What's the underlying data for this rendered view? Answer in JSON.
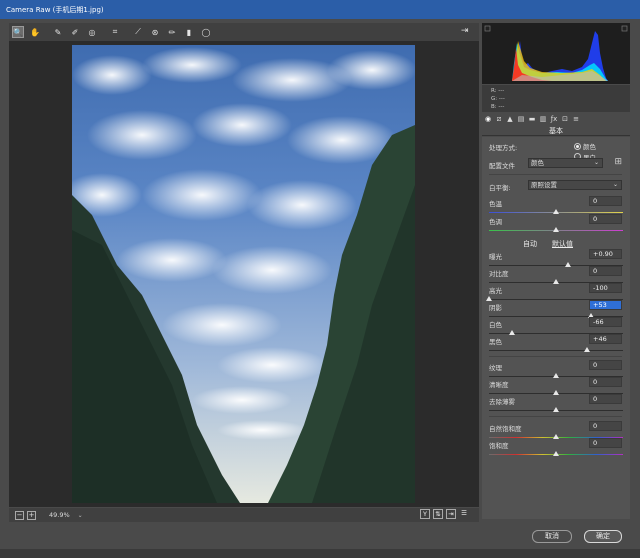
{
  "window": {
    "title": "Camera Raw (手机后期1.jpg)"
  },
  "toolbar": {
    "tools": [
      {
        "name": "zoom-tool",
        "glyph": "🔍"
      },
      {
        "name": "hand-tool",
        "glyph": "✋"
      },
      {
        "name": "white-balance-tool",
        "glyph": "✎"
      },
      {
        "name": "color-sampler-tool",
        "glyph": "✐"
      },
      {
        "name": "targeted-adjustment-tool",
        "glyph": "◎"
      },
      {
        "name": "crop-tool",
        "glyph": "⌗"
      },
      {
        "name": "straighten-tool",
        "glyph": "⟋"
      },
      {
        "name": "spot-removal-tool",
        "glyph": "⊛"
      },
      {
        "name": "adjustment-brush-tool",
        "glyph": "✏"
      },
      {
        "name": "graduated-filter-tool",
        "glyph": "▮"
      },
      {
        "name": "radial-filter-tool",
        "glyph": "◯"
      }
    ]
  },
  "status": {
    "zoom": "49.9%"
  },
  "rgb_readout": {
    "r": "R:",
    "g": "G:",
    "b": "B:",
    "dashes": "---"
  },
  "panel": {
    "title": "基本",
    "process_label": "处理方式:",
    "process_color": "颜色",
    "process_bw": "黑白",
    "profile_label": "配置文件",
    "profile_value": "颜色",
    "wb_label": "白平衡:",
    "wb_value": "原照设置",
    "temp_label": "色温",
    "temp_value": "0",
    "tint_label": "色调",
    "tint_value": "0",
    "auto_label": "自动",
    "default_label": "默认值",
    "exposure_label": "曝光",
    "exposure_value": "+0.90",
    "contrast_label": "对比度",
    "contrast_value": "0",
    "highlights_label": "高光",
    "highlights_value": "-100",
    "shadows_label": "阴影",
    "shadows_value": "+53",
    "whites_label": "白色",
    "whites_value": "-66",
    "blacks_label": "黑色",
    "blacks_value": "+46",
    "texture_label": "纹理",
    "texture_value": "0",
    "clarity_label": "清晰度",
    "clarity_value": "0",
    "dehaze_label": "去除薄雾",
    "dehaze_value": "0",
    "vibrance_label": "自然饱和度",
    "vibrance_value": "0",
    "saturation_label": "饱和度",
    "saturation_value": "0"
  },
  "sliders": {
    "temp": 0.5,
    "tint": 0.5,
    "exposure": 0.59,
    "contrast": 0.5,
    "highlights": 0.0,
    "shadows": 0.76,
    "whites": 0.17,
    "blacks": 0.73,
    "texture": 0.5,
    "clarity": 0.5,
    "dehaze": 0.5,
    "vibrance": 0.5,
    "saturation": 0.5
  },
  "footer": {
    "cancel_label": "取消",
    "ok_label": "确定"
  },
  "colors": {
    "titlebar": "#2b5ea8",
    "selection": "#2f6fd6"
  }
}
